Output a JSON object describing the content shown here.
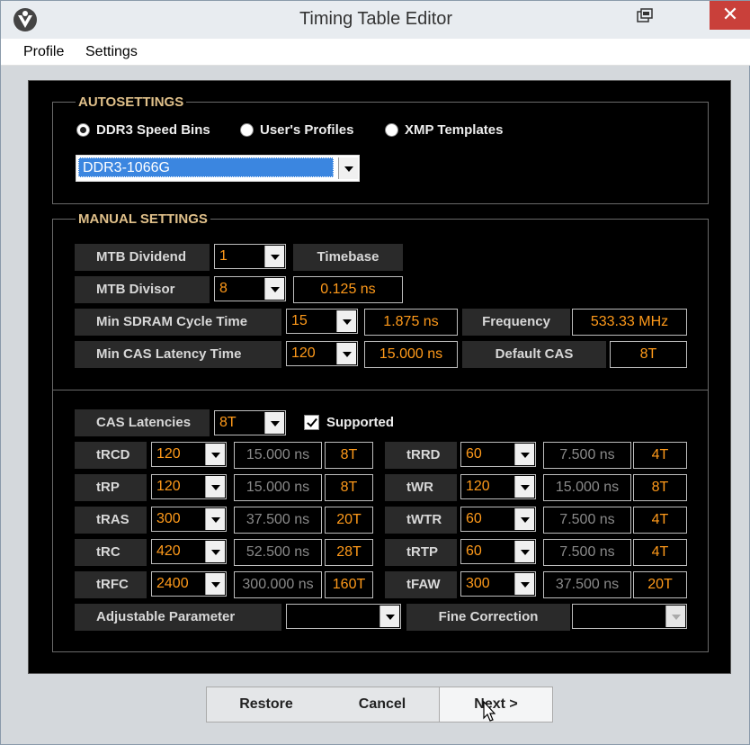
{
  "window": {
    "title": "Timing Table Editor",
    "close_glyph": "✕"
  },
  "menu": [
    "Profile",
    "Settings"
  ],
  "autosettings": {
    "label": "AUTOSETTINGS",
    "radios": [
      {
        "label": "DDR3 Speed Bins",
        "selected": true
      },
      {
        "label": "User's Profiles",
        "selected": false
      },
      {
        "label": "XMP Templates",
        "selected": false
      }
    ],
    "dropdown_value": "DDR3-1066G"
  },
  "manual": {
    "label": "MANUAL SETTINGS",
    "mtb_dividend": {
      "label": "MTB Dividend",
      "value": "1"
    },
    "timebase": {
      "label": "Timebase"
    },
    "mtb_divisor": {
      "label": "MTB Divisor",
      "value": "8",
      "result": "0.125 ns"
    },
    "min_cycle": {
      "label": "Min SDRAM Cycle Time",
      "value": "15",
      "result": "1.875 ns"
    },
    "frequency": {
      "label": "Frequency",
      "value": "533.33 MHz"
    },
    "min_cas": {
      "label": "Min CAS Latency Time",
      "value": "120",
      "result": "15.000 ns"
    },
    "default_cas": {
      "label": "Default CAS",
      "value": "8T"
    }
  },
  "timings": {
    "cas_latencies": {
      "label": "CAS Latencies",
      "value": "8T"
    },
    "supported": {
      "label": "Supported",
      "checked": true
    },
    "left": [
      {
        "label": "tRCD",
        "value": "120",
        "ns": "15.000 ns",
        "t": "8T"
      },
      {
        "label": "tRP",
        "value": "120",
        "ns": "15.000 ns",
        "t": "8T"
      },
      {
        "label": "tRAS",
        "value": "300",
        "ns": "37.500 ns",
        "t": "20T"
      },
      {
        "label": "tRC",
        "value": "420",
        "ns": "52.500 ns",
        "t": "28T"
      },
      {
        "label": "tRFC",
        "value": "2400",
        "ns": "300.000 ns",
        "t": "160T"
      }
    ],
    "right": [
      {
        "label": "tRRD",
        "value": "60",
        "ns": "7.500 ns",
        "t": "4T"
      },
      {
        "label": "tWR",
        "value": "120",
        "ns": "15.000 ns",
        "t": "8T"
      },
      {
        "label": "tWTR",
        "value": "60",
        "ns": "7.500 ns",
        "t": "4T"
      },
      {
        "label": "tRTP",
        "value": "60",
        "ns": "7.500 ns",
        "t": "4T"
      },
      {
        "label": "tFAW",
        "value": "300",
        "ns": "37.500 ns",
        "t": "20T"
      }
    ],
    "adjustable": {
      "label": "Adjustable Parameter",
      "value": ""
    },
    "fine_correction": {
      "label": "Fine Correction",
      "value": ""
    }
  },
  "buttons": {
    "restore": "Restore",
    "cancel": "Cancel",
    "next": "Next >"
  },
  "colors": {
    "accent_orange": "#ff9a1a",
    "group_label": "#e0c08a",
    "selection_blue": "#3b86e0",
    "close_red": "#c9403a"
  }
}
